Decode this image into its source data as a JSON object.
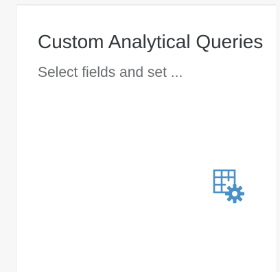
{
  "tile": {
    "title": "Custom Analytical Queries",
    "subtitle": "Select fields and set ...",
    "icon": "table-settings-icon",
    "icon_color": "#4a90c7"
  }
}
